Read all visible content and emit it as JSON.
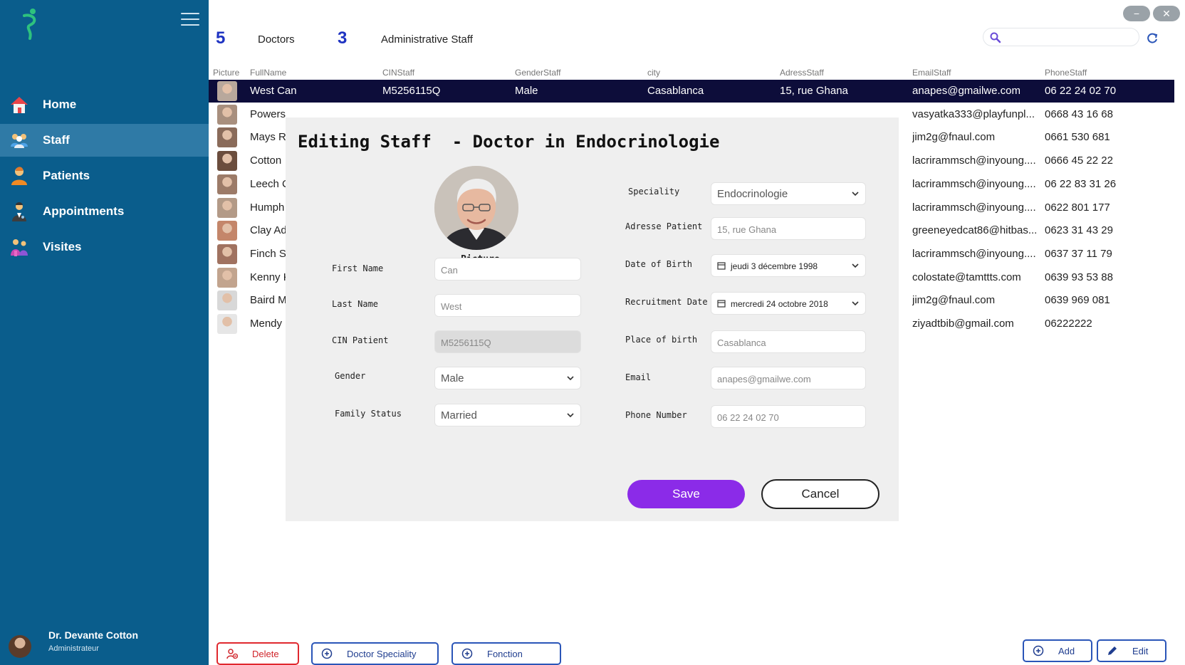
{
  "sidebar": {
    "nav": [
      {
        "label": "Home",
        "icon": "home-icon"
      },
      {
        "label": "Staff",
        "icon": "staff-icon",
        "active": true
      },
      {
        "label": "Patients",
        "icon": "patient-icon"
      },
      {
        "label": "Appointments",
        "icon": "appointment-icon"
      },
      {
        "label": "Visites",
        "icon": "visit-icon"
      }
    ],
    "user": {
      "name": "Dr. Devante Cotton",
      "role": "Administrateur"
    }
  },
  "window": {
    "minimize": "−",
    "close": "✕"
  },
  "counts": {
    "doctors_count": "5",
    "doctors_label": "Doctors",
    "admin_count": "3",
    "admin_label": "Administrative Staff"
  },
  "search": {
    "value": "",
    "placeholder": ""
  },
  "table": {
    "columns": [
      "Picture",
      "FullName",
      "CINStaff",
      "GenderStaff",
      "city",
      "AdressStaff",
      "EmailStaff",
      "PhoneStaff"
    ],
    "rows": [
      {
        "name": "West Can",
        "cin": "M5256115Q",
        "gender": "Male",
        "city": "Casablanca",
        "address": "15, rue Ghana",
        "email": "anapes@gmailwe.com",
        "phone": "06 22 24 02 70"
      },
      {
        "name": "Powers",
        "cin": "",
        "gender": "",
        "city": "",
        "address": "",
        "email": "vasyatka333@playfunpl...",
        "phone": "0668 43 16 68"
      },
      {
        "name": "Mays R",
        "cin": "",
        "gender": "",
        "city": "",
        "address": "",
        "email": "jim2g@fnaul.com",
        "phone": "0661 530 681"
      },
      {
        "name": "Cotton",
        "cin": "",
        "gender": "",
        "city": "",
        "address": "",
        "email": "lacrirammsch@inyoung....",
        "phone": "0666 45 22 22"
      },
      {
        "name": "Leech C",
        "cin": "",
        "gender": "",
        "city": "",
        "address": "",
        "email": "lacrirammsch@inyoung....",
        "phone": "06 22 83 31 26"
      },
      {
        "name": "Humph",
        "cin": "",
        "gender": "",
        "city": "",
        "address": "",
        "email": "lacrirammsch@inyoung....",
        "phone": "0622 801 177"
      },
      {
        "name": "Clay Ad",
        "cin": "",
        "gender": "",
        "city": "",
        "address": "",
        "email": "greeneyedcat86@hitbas...",
        "phone": "0623 31 43 29"
      },
      {
        "name": "Finch St",
        "cin": "",
        "gender": "",
        "city": "",
        "address": "",
        "email": "lacrirammsch@inyoung....",
        "phone": "0637 37 11 79"
      },
      {
        "name": "Kenny K",
        "cin": "",
        "gender": "",
        "city": "",
        "address": "",
        "email": "colostate@tamttts.com",
        "phone": "0639 93 53 88"
      },
      {
        "name": "Baird M",
        "cin": "",
        "gender": "",
        "city": "",
        "address": "",
        "email": "jim2g@fnaul.com",
        "phone": "0639 969 081"
      },
      {
        "name": "Mendy",
        "cin": "",
        "gender": "",
        "city": "",
        "address": "",
        "email": "ziyadtbib@gmail.com",
        "phone": "06222222"
      }
    ]
  },
  "modal": {
    "title": "Editing Staff  - Doctor in Endocrinologie",
    "picture_label": "Picture",
    "first_name": {
      "label": "First Name",
      "value": "Can"
    },
    "last_name": {
      "label": "Last Name",
      "value": "West"
    },
    "cin": {
      "label": "CIN Patient",
      "value": "M5256115Q"
    },
    "gender": {
      "label": "Gender",
      "value": "Male"
    },
    "family_status": {
      "label": "Family Status",
      "value": "Married"
    },
    "speciality": {
      "label": "Speciality",
      "value": "Endocrinologie"
    },
    "address": {
      "label": "Adresse Patient",
      "value": "15, rue Ghana"
    },
    "dob": {
      "label": "Date of Birth",
      "value": "jeudi 3 décembre 1998"
    },
    "recruitment": {
      "label": "Recruitment Date",
      "value": "mercredi 24 octobre 2018"
    },
    "birthplace": {
      "label": "Place of birth",
      "value": "Casablanca"
    },
    "email": {
      "label": "Email",
      "value": "anapes@gmailwe.com"
    },
    "phone": {
      "label": "Phone Number",
      "value": "06 22 24 02 70"
    },
    "save": "Save",
    "cancel": "Cancel"
  },
  "actions": {
    "delete": "Delete",
    "doctor_speciality": "Doctor Speciality",
    "fonction": "Fonction",
    "add": "Add",
    "edit": "Edit"
  },
  "colors": {
    "sidebar": "#0a5d8c",
    "sidebar_active": "#2f7aa6",
    "selected_row": "#0d0d3a",
    "save": "#8b2be8",
    "count": "#1e33c2",
    "danger": "#e0282e"
  }
}
